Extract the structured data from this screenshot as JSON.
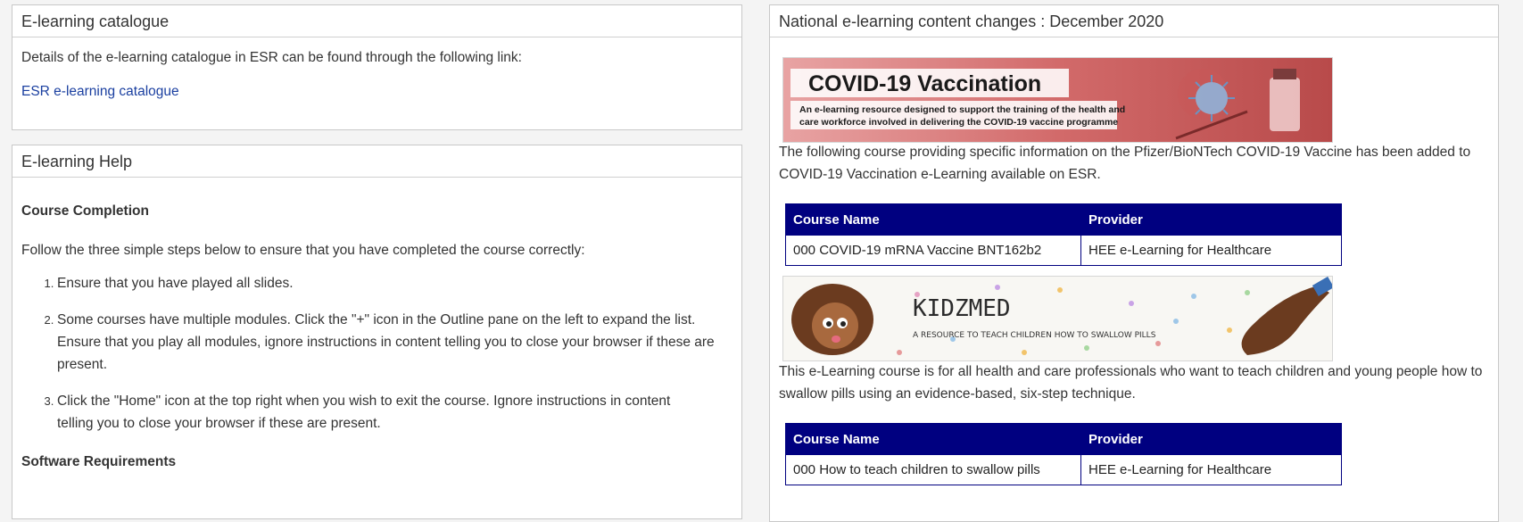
{
  "catalogue": {
    "title": "E-learning catalogue",
    "description": "Details of the e-learning catalogue in ESR can be found through the following link:",
    "link_label": "ESR e-learning catalogue"
  },
  "help": {
    "title": "E-learning Help",
    "course_completion_heading": "Course Completion",
    "intro": "Follow the three simple steps below to ensure that you have completed the course correctly:",
    "steps": [
      "Ensure that you have played all slides.",
      "Some courses have multiple modules. Click the \"+\" icon in the Outline pane on the left to expand the list. Ensure that you play all modules, ignore instructions in content telling you to close your browser if these are present.",
      "Click the \"Home\" icon at the top right when you wish to exit the course. Ignore instructions in content telling you to close your browser if these are present."
    ],
    "software_heading": "Software Requirements"
  },
  "changes": {
    "title": "National e-learning content changes : December 2020",
    "banner1": {
      "heading": "COVID-19 Vaccination",
      "subtitle_line1": "An e-learning resource designed to support the training of the health and",
      "subtitle_line2": "care workforce involved in delivering the COVID-19 vaccine programme"
    },
    "paragraph1": "The following course providing specific information on the Pfizer/BioNTech COVID-19 Vaccine has been added to COVID-19 Vaccination e-Learning available on ESR.",
    "table_headers": {
      "course_name": "Course Name",
      "provider": "Provider"
    },
    "table1": {
      "course": "000 COVID-19 mRNA Vaccine BNT162b2",
      "provider": "HEE e-Learning for Healthcare"
    },
    "banner2": {
      "heading": "KIDZMED",
      "subtitle": "A RESOURCE TO TEACH CHILDREN HOW TO SWALLOW PILLS"
    },
    "paragraph2": "This e-Learning course is for all health and care professionals who want to teach children and young people how to swallow pills using an evidence-based, six-step technique.",
    "table2": {
      "course": "000 How to teach children to swallow pills",
      "provider": "HEE e-Learning for Healthcare"
    }
  },
  "colors": {
    "table_header_bg": "#000080",
    "link": "#1a3fa0",
    "panel_border": "#c8c8c8"
  }
}
